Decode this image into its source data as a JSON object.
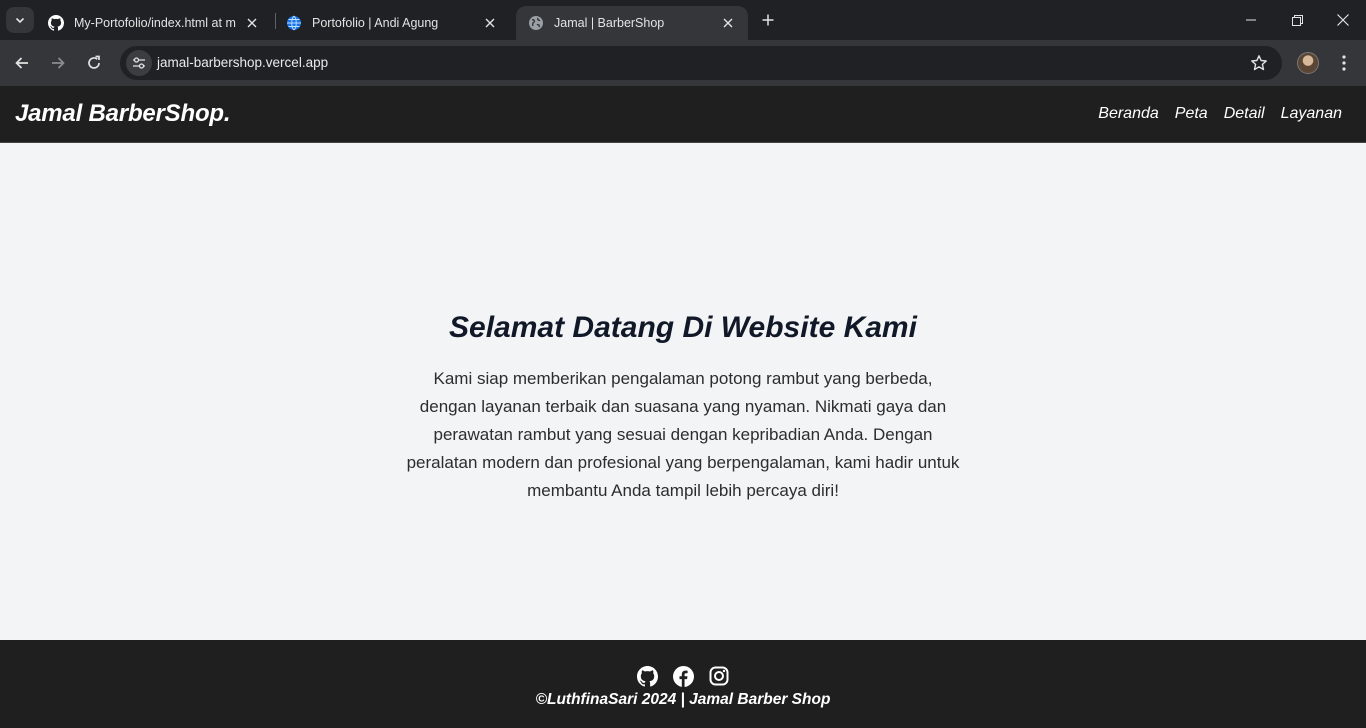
{
  "browser": {
    "tabs": [
      {
        "title": "My-Portofolio/index.html at ma",
        "favicon": "github-icon",
        "active": false
      },
      {
        "title": "Portofolio | Andi Agung",
        "favicon": "globe-icon",
        "active": false
      },
      {
        "title": "Jamal | BarberShop",
        "favicon": "globe-icon",
        "active": true
      }
    ],
    "url": "jamal-barbershop.vercel.app",
    "colors": {
      "tabbar": "#202124",
      "toolbar": "#35363a",
      "omnibox": "#202124"
    }
  },
  "site": {
    "brand": "Jamal BarberShop.",
    "nav": [
      "Beranda",
      "Peta",
      "Detail",
      "Layanan"
    ],
    "hero": {
      "title": "Selamat Datang Di Website Kami",
      "description": "Kami siap memberikan pengalaman potong rambut yang berbeda, dengan layanan terbaik dan suasana yang nyaman. Nikmati gaya dan perawatan rambut yang sesuai dengan kepribadian Anda. Dengan peralatan modern dan profesional yang berpengalaman, kami hadir untuk membantu Anda tampil lebih percaya diri!"
    },
    "footer": {
      "socials": [
        "github-icon",
        "facebook-icon",
        "instagram-icon"
      ],
      "copyright": "©LuthfinaSari 2024 | Jamal Barber Shop"
    },
    "colors": {
      "header": "#1f1f1f",
      "background": "#f3f4f6",
      "footer": "#1f1f1f",
      "heading": "#111827"
    }
  }
}
